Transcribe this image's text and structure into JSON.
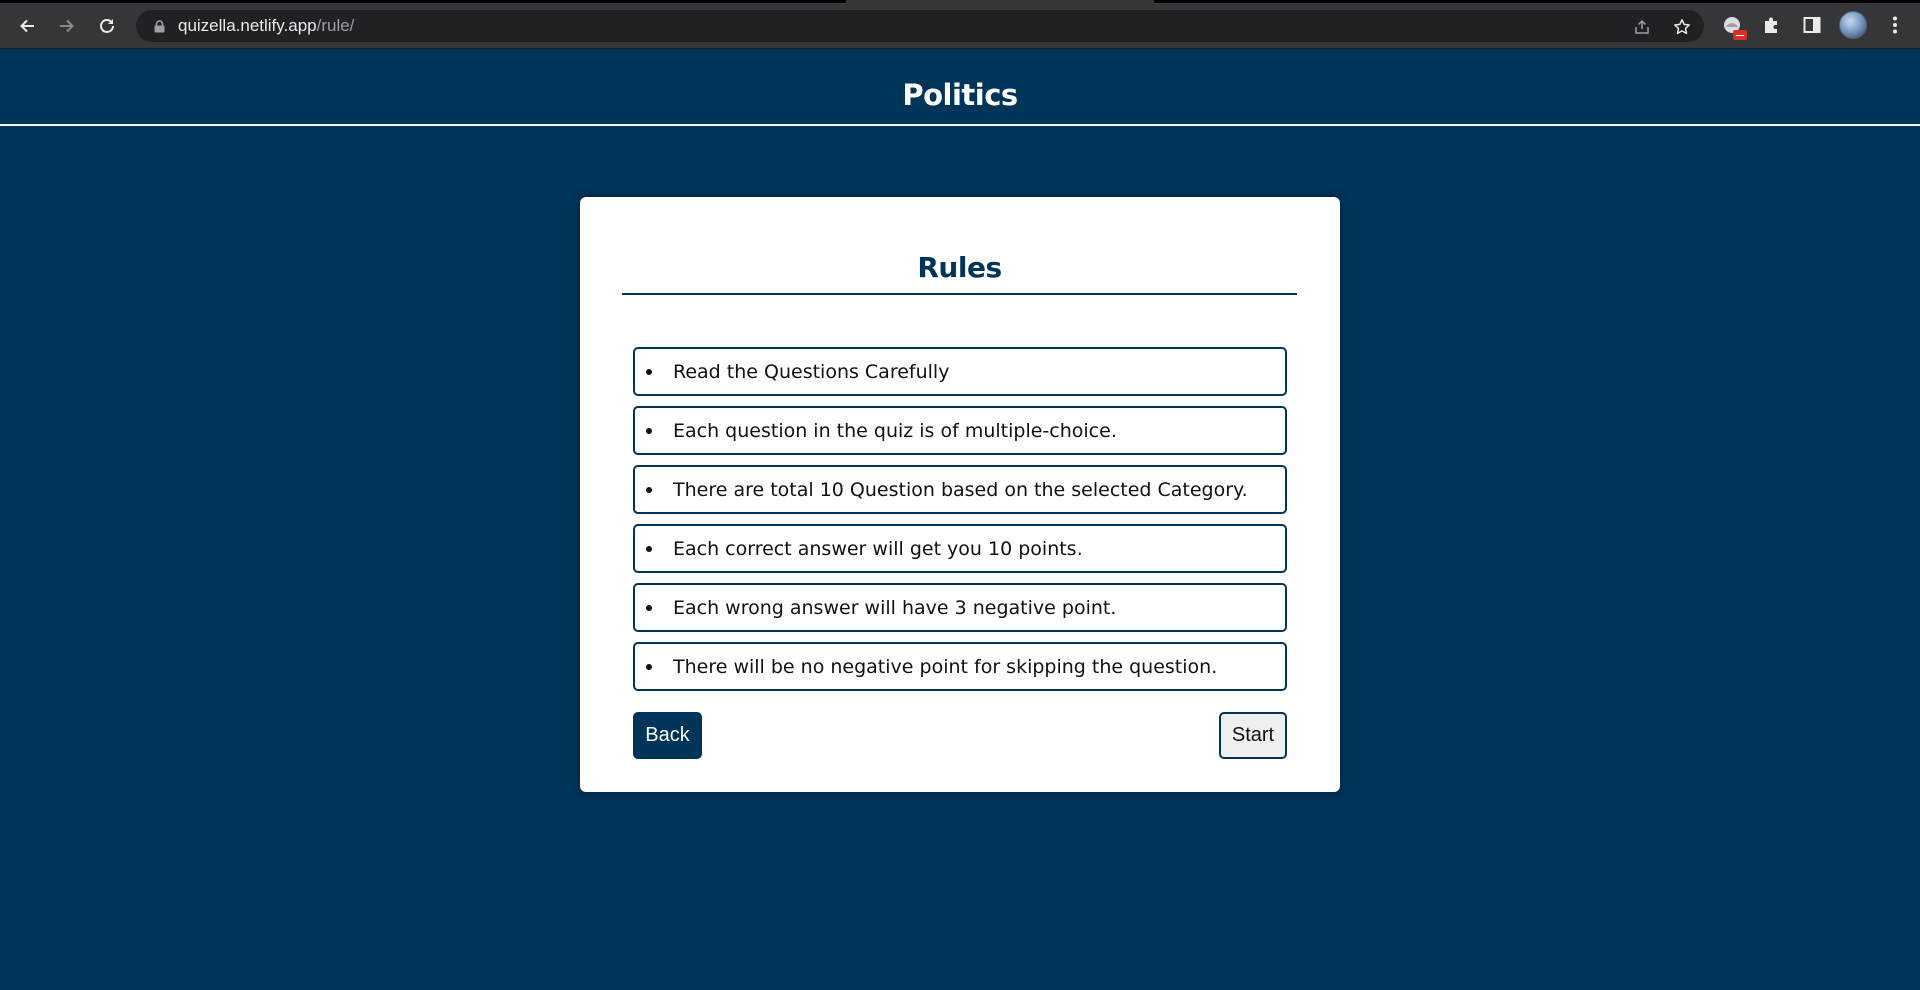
{
  "browser": {
    "url_host": "quizella.netlify.app",
    "url_path": "/rule/",
    "icons": {
      "back": "back-arrow-icon",
      "forward": "forward-arrow-icon",
      "reload": "reload-icon",
      "lock": "lock-icon",
      "share": "share-icon",
      "bookmark": "star-icon",
      "extension": "extension-icon",
      "puzzle": "puzzle-icon",
      "side_panel": "side-panel-icon",
      "profile": "avatar",
      "menu": "kebab-menu-icon"
    }
  },
  "header": {
    "title": "Politics"
  },
  "rules_card": {
    "title": "Rules",
    "items": [
      "Read the Questions Carefully",
      "Each question in the quiz is of multiple-choice.",
      "There are total 10 Question based on the selected Category.",
      "Each correct answer will get you 10 points.",
      "Each wrong answer will have 3 negative point.",
      "There will be no negative point for skipping the question."
    ],
    "back_label": "Back",
    "start_label": "Start"
  },
  "colors": {
    "page_background": "#003459",
    "card_background": "#ffffff",
    "accent": "#003459",
    "start_button_background": "#efefef",
    "chrome_background": "#35363a",
    "omnibox_background": "#202124"
  }
}
